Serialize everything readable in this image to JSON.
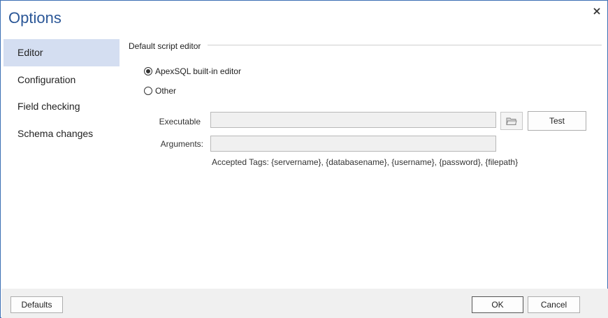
{
  "window": {
    "title": "Options"
  },
  "sidebar": {
    "items": [
      {
        "label": "Editor",
        "active": true
      },
      {
        "label": "Configuration",
        "active": false
      },
      {
        "label": "Field checking",
        "active": false
      },
      {
        "label": "Schema changes",
        "active": false
      }
    ]
  },
  "editor": {
    "group_label": "Default script editor",
    "radio_builtin": {
      "label": "ApexSQL built-in editor",
      "selected": true
    },
    "radio_other": {
      "label": "Other",
      "selected": false
    },
    "executable": {
      "label": "Executable",
      "value": ""
    },
    "arguments": {
      "label": "Arguments:",
      "value": ""
    },
    "test_label": "Test",
    "accepted_tags": "Accepted Tags: {servername}, {databasename}, {username}, {password}, {filepath}"
  },
  "footer": {
    "defaults_label": "Defaults",
    "ok_label": "OK",
    "cancel_label": "Cancel"
  },
  "icons": {
    "close": "close-icon",
    "folder": "folder-open-icon"
  },
  "colors": {
    "accent": "#2b5797",
    "selected_item": "#d4def1",
    "border": "#3c6fb4"
  }
}
